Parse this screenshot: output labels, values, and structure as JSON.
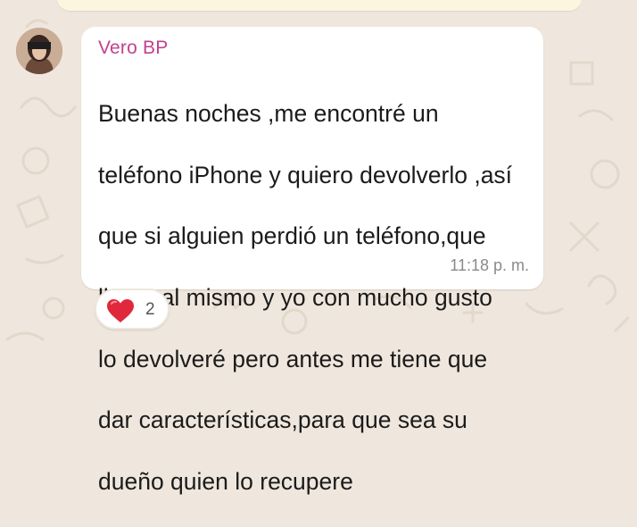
{
  "chat": {
    "previous_bubble_color": "#fdf6de",
    "message": {
      "sender": "Vero BP",
      "sender_color": "#c2418f",
      "text_lines": [
        "Buenas noches ,me encontré un",
        "teléfono iPhone y quiero devolverlo ,así",
        "que si alguien perdió un teléfono,que",
        "llame al mismo y yo con mucho gusto",
        "lo devolveré pero antes me tiene que",
        "dar características,para que sea su",
        "dueño quien lo recupere"
      ],
      "time": "11:18 p. m."
    },
    "reaction": {
      "icon": "red-heart-icon",
      "count": "2"
    }
  }
}
